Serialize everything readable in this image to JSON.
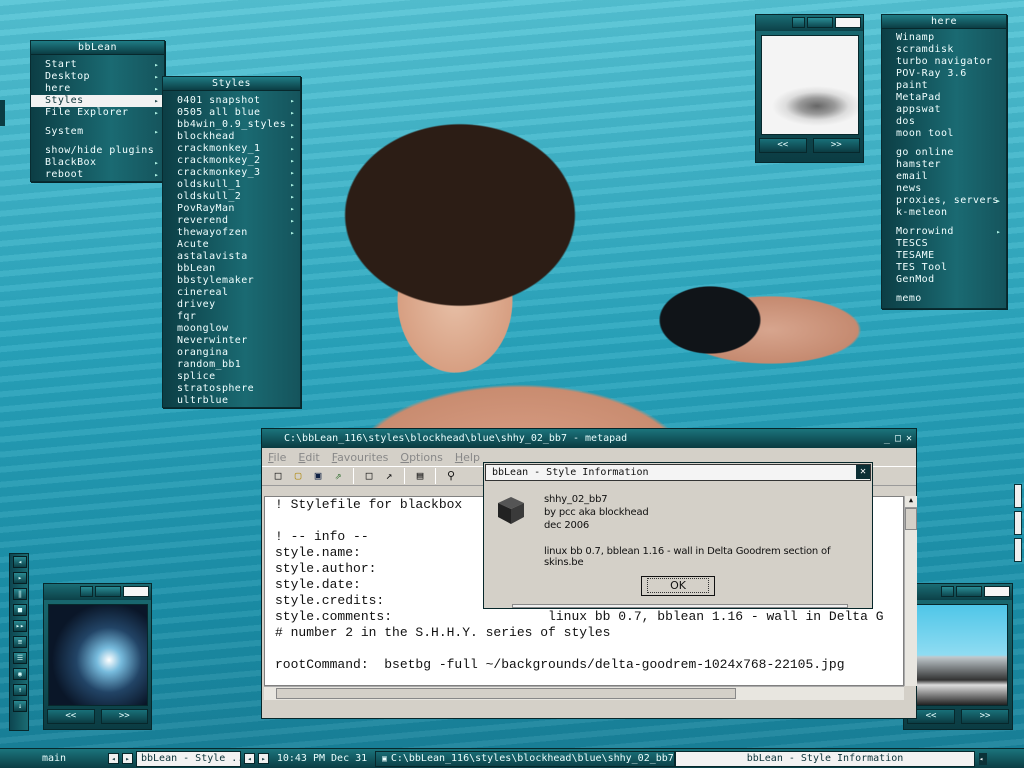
{
  "menus": {
    "bblean": {
      "title": "bbLean",
      "items": [
        {
          "label": "Start",
          "arrow": true
        },
        {
          "label": "Desktop",
          "arrow": true
        },
        {
          "label": "here",
          "arrow": true
        },
        {
          "label": "Styles",
          "arrow": true,
          "selected": true
        },
        {
          "label": "File Explorer",
          "arrow": true
        },
        {
          "gap": true
        },
        {
          "label": "System",
          "arrow": true
        },
        {
          "gap": true
        },
        {
          "label": "show/hide plugins",
          "arrow": false
        },
        {
          "label": "BlackBox",
          "arrow": true
        },
        {
          "label": "reboot",
          "arrow": true
        }
      ]
    },
    "styles": {
      "title": "Styles",
      "items": [
        {
          "label": "0401 snapshot",
          "arrow": true
        },
        {
          "label": "0505 all blue",
          "arrow": true
        },
        {
          "label": "bb4win_0.9_styles",
          "arrow": true
        },
        {
          "label": "blockhead",
          "arrow": true
        },
        {
          "label": "crackmonkey_1",
          "arrow": true
        },
        {
          "label": "crackmonkey_2",
          "arrow": true
        },
        {
          "label": "crackmonkey_3",
          "arrow": true
        },
        {
          "label": "oldskull_1",
          "arrow": true
        },
        {
          "label": "oldskull_2",
          "arrow": true
        },
        {
          "label": "PovRayMan",
          "arrow": true
        },
        {
          "label": "reverend",
          "arrow": true
        },
        {
          "label": "thewayofzen",
          "arrow": true
        },
        {
          "label": "Acute"
        },
        {
          "label": "astalavista"
        },
        {
          "label": "bbLean"
        },
        {
          "label": "bbstylemaker"
        },
        {
          "label": "cinereal"
        },
        {
          "label": "drivey"
        },
        {
          "label": "fqr"
        },
        {
          "label": "moonglow"
        },
        {
          "label": "Neverwinter"
        },
        {
          "label": "orangina"
        },
        {
          "label": "random_bb1"
        },
        {
          "label": "splice"
        },
        {
          "label": "stratosphere"
        },
        {
          "label": "ultrblue"
        }
      ]
    },
    "here": {
      "title": "here",
      "items": [
        {
          "label": "Winamp"
        },
        {
          "label": "scramdisk"
        },
        {
          "label": "turbo navigator"
        },
        {
          "label": "POV-Ray 3.6"
        },
        {
          "label": "paint"
        },
        {
          "label": "MetaPad"
        },
        {
          "label": "appswat"
        },
        {
          "label": "dos"
        },
        {
          "label": "moon tool"
        },
        {
          "gap": true
        },
        {
          "label": "go online"
        },
        {
          "label": "hamster"
        },
        {
          "label": "email"
        },
        {
          "label": "news"
        },
        {
          "label": "proxies, servers",
          "arrow": true
        },
        {
          "label": "k-meleon"
        },
        {
          "gap": true
        },
        {
          "label": "Morrowind",
          "arrow": true
        },
        {
          "label": "TESCS"
        },
        {
          "label": "TESAME"
        },
        {
          "label": "TES Tool"
        },
        {
          "label": "GenMod"
        },
        {
          "gap": true
        },
        {
          "label": "memo"
        }
      ]
    }
  },
  "widgets": {
    "prev": "<<",
    "next": ">>"
  },
  "left_toolbar": [
    "◂",
    "▸",
    "‖",
    "■",
    "▸▸",
    "≡",
    "☰",
    "◉",
    "↑",
    "↓"
  ],
  "metapad": {
    "title": "C:\\bbLean_116\\styles\\blockhead\\blue\\shhy_02_bb7 - metapad",
    "controls": [
      "_",
      "□",
      "✕"
    ],
    "menu": [
      "File",
      "Edit",
      "Favourites",
      "Options",
      "Help"
    ],
    "toolbar_icons": [
      "new-icon",
      "open-icon",
      "save-icon",
      "export-icon",
      "find-icon",
      "goto-icon",
      "print-icon",
      "search-icon"
    ],
    "lines": [
      "! Stylefile for blackbox",
      "",
      "! -- info --",
      "style.name:",
      "style.author:",
      "style.date:",
      "style.credits:",
      "style.comments:                    linux bb 0.7, bblean 1.16 - wall in Delta G",
      "# number 2 in the S.H.H.Y. series of styles",
      "",
      "rootCommand:  bsetbg -full ~/backgrounds/delta-goodrem-1024x768-22105.jpg"
    ]
  },
  "dialog": {
    "title": "bbLean - Style Information",
    "name": "shhy_02_bb7",
    "author": "by pcc aka blockhead",
    "date": "dec 2006",
    "comment": "linux bb 0.7, bblean 1.16 - wall in Delta Goodrem section of skins.be",
    "ok": "OK"
  },
  "taskbar": {
    "workspace": "main",
    "current": "bbLean - Style ...",
    "clock": "10:43 PM Dec 31",
    "tasks": [
      "C:\\bbLean_116\\styles\\blockhead\\blue\\shhy_02_bb7 - metapad",
      "bbLean - Style Information"
    ]
  },
  "colors": {
    "accent": "#1a6c74",
    "dark": "#0b3c43",
    "highlight": "#f2f2f2"
  }
}
